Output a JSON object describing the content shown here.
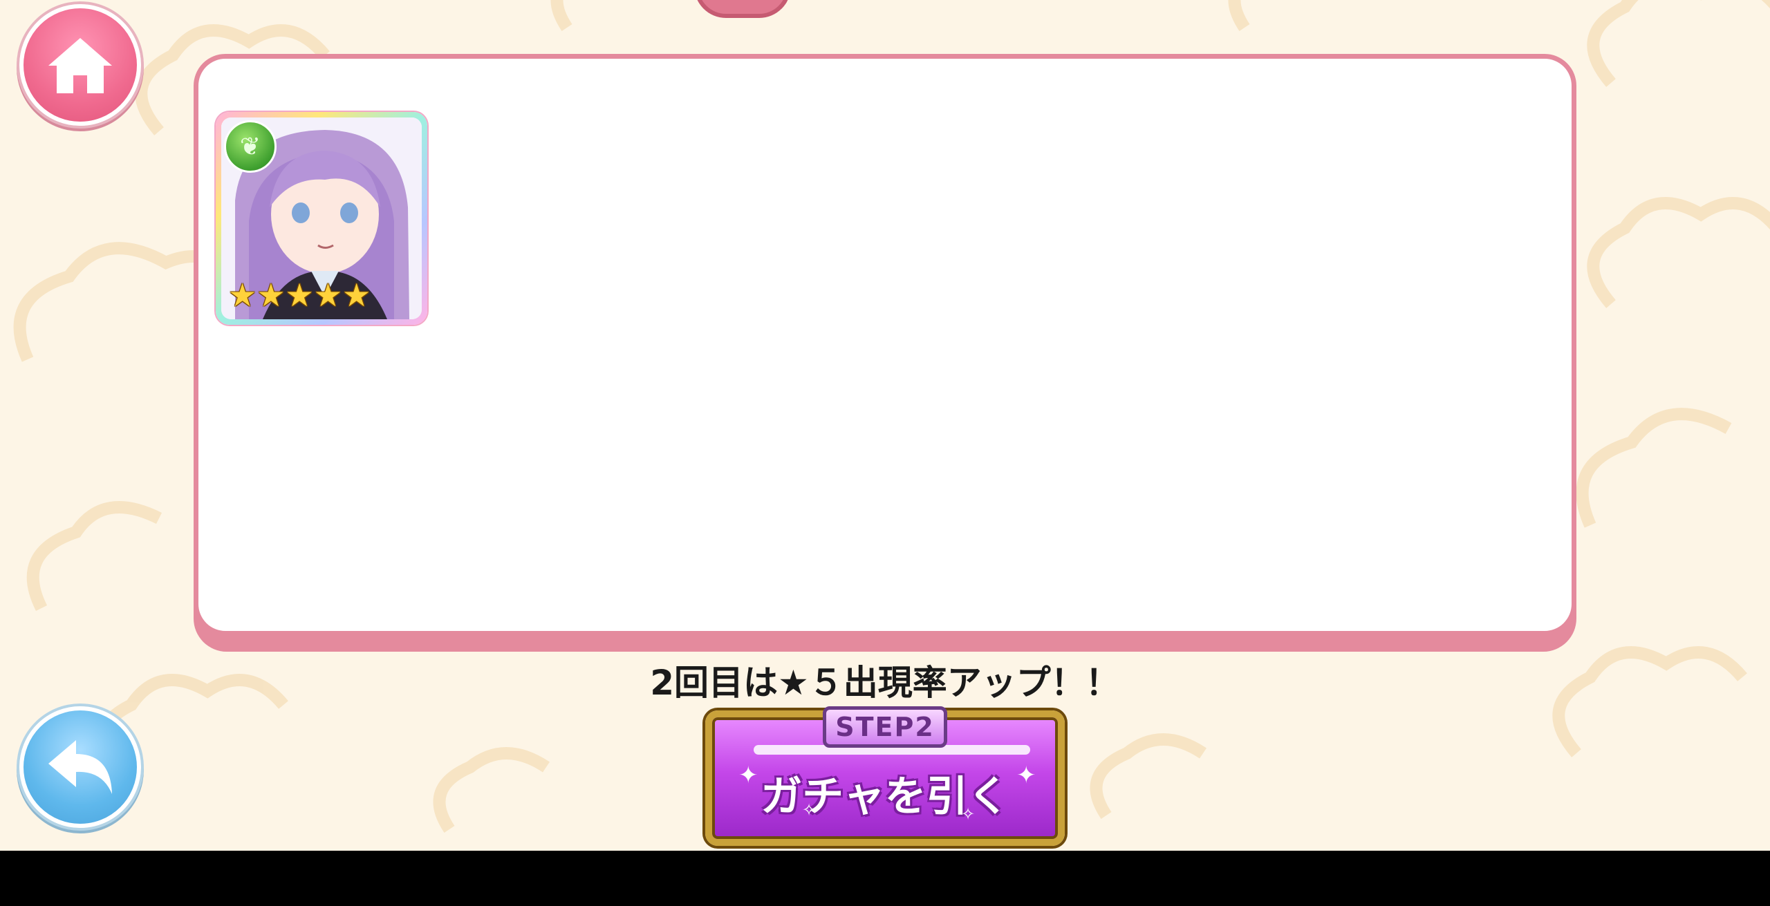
{
  "header": {
    "home_icon": "home-icon"
  },
  "navigation": {
    "back_icon": "back-arrow-icon"
  },
  "result_panel": {
    "cards": [
      {
        "attribute_icon": "leaf-attribute-icon",
        "rarity": 5,
        "star_glyph": "★"
      }
    ]
  },
  "notice": {
    "text": "2回目は★５出現率アップ！！"
  },
  "gacha_button": {
    "step_label": "STEP2",
    "label": "ガチャを引く"
  },
  "colors": {
    "background": "#fdf5e6",
    "panel_border": "#e48a9d",
    "home_button": "#f06a8f",
    "back_button": "#5fb8ec",
    "gacha_purple": "#c447e9",
    "gold_frame": "#c9a23a"
  }
}
